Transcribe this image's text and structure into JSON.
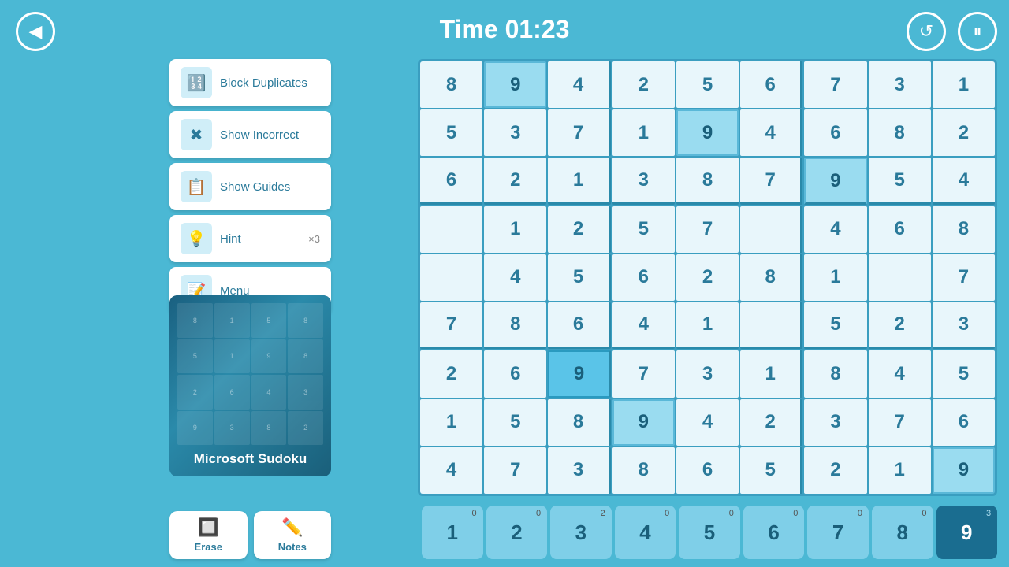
{
  "header": {
    "timer_label": "Time 01:23",
    "back_icon": "◀",
    "undo_icon": "↺",
    "pause_icon": "⏸"
  },
  "menu": {
    "block_duplicates_label": "Block Duplicates",
    "show_incorrect_label": "Show Incorrect",
    "show_guides_label": "Show Guides",
    "hint_label": "Hint",
    "hint_count": "×3",
    "menu_label": "Menu"
  },
  "thumbnail": {
    "title": "Microsoft Sudoku"
  },
  "toolbar": {
    "erase_label": "Erase",
    "notes_label": "Notes"
  },
  "number_pad": [
    {
      "num": "1",
      "count": "0"
    },
    {
      "num": "2",
      "count": "0"
    },
    {
      "num": "3",
      "count": "2"
    },
    {
      "num": "4",
      "count": "0"
    },
    {
      "num": "5",
      "count": "0"
    },
    {
      "num": "6",
      "count": "0"
    },
    {
      "num": "7",
      "count": "0"
    },
    {
      "num": "8",
      "count": "0"
    },
    {
      "num": "9",
      "count": "3"
    }
  ],
  "grid": {
    "cells": [
      [
        "8",
        "9",
        "4",
        "2",
        "5",
        "6",
        "7",
        "3",
        "1"
      ],
      [
        "5",
        "3",
        "7",
        "1",
        "9",
        "4",
        "6",
        "8",
        "2"
      ],
      [
        "6",
        "2",
        "1",
        "3",
        "8",
        "7",
        "9",
        "5",
        "4"
      ],
      [
        "",
        "1",
        "2",
        "5",
        "7",
        "",
        "4",
        "6",
        "8"
      ],
      [
        "",
        "4",
        "5",
        "6",
        "2",
        "8",
        "1",
        "",
        "7"
      ],
      [
        "7",
        "8",
        "6",
        "4",
        "1",
        "",
        "5",
        "2",
        "3"
      ],
      [
        "2",
        "6",
        "9",
        "7",
        "3",
        "1",
        "8",
        "4",
        "5"
      ],
      [
        "1",
        "5",
        "8",
        "9",
        "4",
        "2",
        "3",
        "7",
        "6"
      ],
      [
        "4",
        "7",
        "3",
        "8",
        "6",
        "5",
        "2",
        "1",
        "9"
      ]
    ],
    "highlighted_cells": [
      [
        0,
        1
      ],
      [
        1,
        4
      ],
      [
        2,
        6
      ],
      [
        6,
        2
      ],
      [
        7,
        3
      ],
      [
        8,
        8
      ]
    ],
    "selected_cell": [
      6,
      2
    ]
  }
}
